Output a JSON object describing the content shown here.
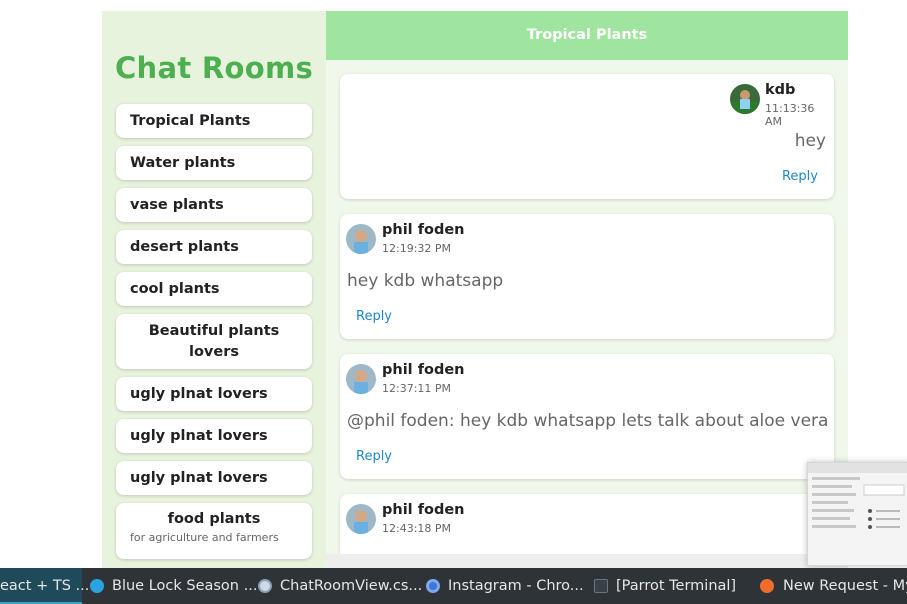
{
  "sidebar": {
    "title": "Chat Rooms",
    "rooms": [
      {
        "label": "Tropical Plants"
      },
      {
        "label": "Water plants"
      },
      {
        "label": "vase plants"
      },
      {
        "label": "desert plants"
      },
      {
        "label": "cool plants"
      },
      {
        "label": "Beautiful plants lovers"
      },
      {
        "label": "ugly plnat lovers"
      },
      {
        "label": "ugly plnat lovers"
      },
      {
        "label": "ugly plnat lovers"
      },
      {
        "label": "food plants",
        "description": "for agriculture and farmers"
      }
    ]
  },
  "chat": {
    "header": "Tropical Plants",
    "reply_label": "Reply",
    "messages": [
      {
        "user": "kdb",
        "time": "11:13:36 AM",
        "text": "hey",
        "own": true
      },
      {
        "user": "phil foden",
        "time": "12:19:32 PM",
        "text": "hey kdb whatsapp",
        "own": false
      },
      {
        "user": "phil foden",
        "time": "12:37:11 PM",
        "text": "@phil foden: hey kdb whatsapp lets talk about aloe vera",
        "own": false
      },
      {
        "user": "phil foden",
        "time": "12:43:18 PM",
        "text": "",
        "own": false
      }
    ]
  },
  "taskbar": {
    "items": [
      {
        "label": "eact + TS ...",
        "icon": "terminal-icon",
        "active": true
      },
      {
        "label": "Blue Lock Season ...",
        "icon": "telegram-icon"
      },
      {
        "label": "ChatRoomView.cs...",
        "icon": "code-editor-icon"
      },
      {
        "label": "Instagram - Chro...",
        "icon": "chrome-icon"
      },
      {
        "label": "[Parrot Terminal]",
        "icon": "terminal-icon"
      },
      {
        "label": "New Request - My A",
        "icon": "postman-icon"
      }
    ]
  },
  "colors": {
    "accent_green": "#4cb050",
    "header_green": "#9fe59f",
    "sidebar_bg": "#e8f3de",
    "chat_bg": "#eff8ea",
    "link_blue": "#1e88c8"
  }
}
